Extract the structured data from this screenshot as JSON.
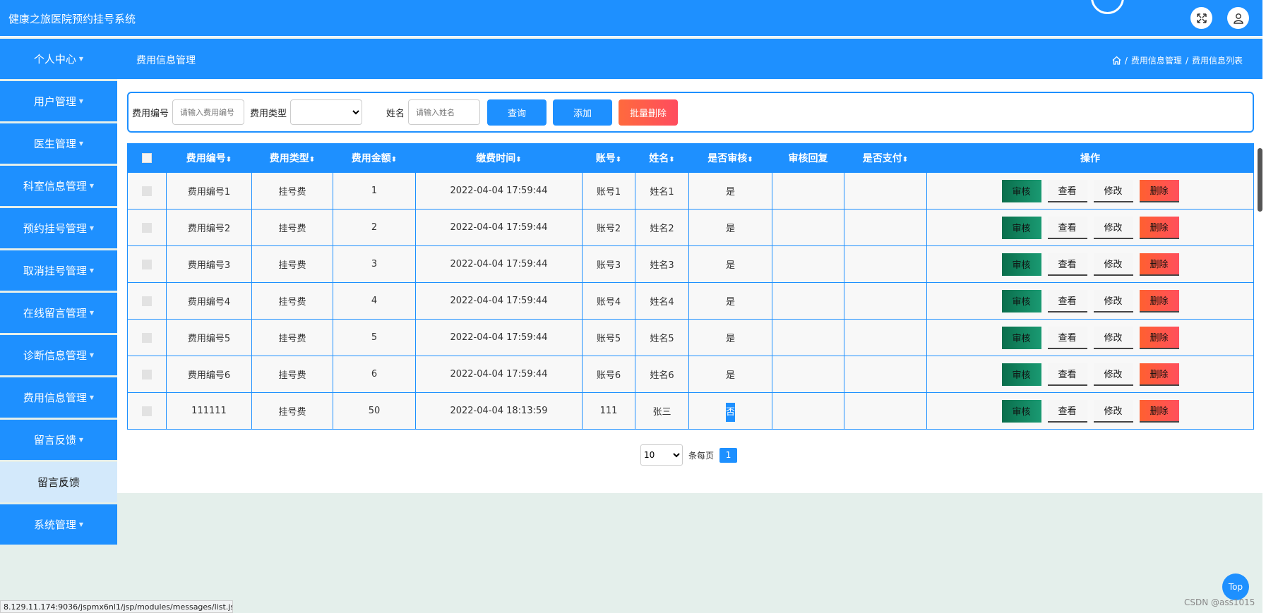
{
  "app": {
    "title": "健康之旅医院预约挂号系统"
  },
  "sidebar": {
    "items": [
      {
        "label": "个人中心"
      },
      {
        "label": "用户管理"
      },
      {
        "label": "医生管理"
      },
      {
        "label": "科室信息管理"
      },
      {
        "label": "预约挂号管理"
      },
      {
        "label": "取消挂号管理"
      },
      {
        "label": "在线留言管理"
      },
      {
        "label": "诊断信息管理"
      },
      {
        "label": "费用信息管理"
      },
      {
        "label": "留言反馈"
      },
      {
        "label": "留言反馈"
      },
      {
        "label": "系统管理"
      }
    ]
  },
  "header": {
    "page_title": "费用信息管理",
    "breadcrumb": [
      "费用信息管理",
      "费用信息列表"
    ]
  },
  "search": {
    "fee_no_label": "费用编号",
    "fee_no_placeholder": "请输入费用编号",
    "fee_type_label": "费用类型",
    "name_label": "姓名",
    "name_placeholder": "请输入姓名",
    "query_button": "查询",
    "add_button": "添加",
    "batch_delete_button": "批量删除"
  },
  "table": {
    "headers": {
      "fee_no": "费用编号",
      "fee_type": "费用类型",
      "amount": "费用金额",
      "pay_time": "缴费时间",
      "account": "账号",
      "name": "姓名",
      "reviewed": "是否审核",
      "review_reply": "审核回复",
      "paid": "是否支付",
      "ops": "操作"
    },
    "rows": [
      {
        "fee_no": "费用编号1",
        "fee_type": "挂号费",
        "amount": "1",
        "pay_time": "2022-04-04 17:59:44",
        "account": "账号1",
        "name": "姓名1",
        "reviewed": "是",
        "review_reply": "",
        "paid": ""
      },
      {
        "fee_no": "费用编号2",
        "fee_type": "挂号费",
        "amount": "2",
        "pay_time": "2022-04-04 17:59:44",
        "account": "账号2",
        "name": "姓名2",
        "reviewed": "是",
        "review_reply": "",
        "paid": ""
      },
      {
        "fee_no": "费用编号3",
        "fee_type": "挂号费",
        "amount": "3",
        "pay_time": "2022-04-04 17:59:44",
        "account": "账号3",
        "name": "姓名3",
        "reviewed": "是",
        "review_reply": "",
        "paid": ""
      },
      {
        "fee_no": "费用编号4",
        "fee_type": "挂号费",
        "amount": "4",
        "pay_time": "2022-04-04 17:59:44",
        "account": "账号4",
        "name": "姓名4",
        "reviewed": "是",
        "review_reply": "",
        "paid": ""
      },
      {
        "fee_no": "费用编号5",
        "fee_type": "挂号费",
        "amount": "5",
        "pay_time": "2022-04-04 17:59:44",
        "account": "账号5",
        "name": "姓名5",
        "reviewed": "是",
        "review_reply": "",
        "paid": ""
      },
      {
        "fee_no": "费用编号6",
        "fee_type": "挂号费",
        "amount": "6",
        "pay_time": "2022-04-04 17:59:44",
        "account": "账号6",
        "name": "姓名6",
        "reviewed": "是",
        "review_reply": "",
        "paid": ""
      },
      {
        "fee_no": "111111",
        "fee_type": "挂号费",
        "amount": "50",
        "pay_time": "2022-04-04 18:13:59",
        "account": "111",
        "name": "张三",
        "reviewed": "否",
        "review_reply": "",
        "paid": ""
      }
    ],
    "actions": {
      "audit": "审核",
      "view": "查看",
      "edit": "修改",
      "delete": "删除"
    }
  },
  "pager": {
    "page_size": "10",
    "per_page_label": "条每页",
    "current_page": "1"
  },
  "scroll_top": "Top",
  "watermark": "CSDN @ass1015",
  "status_url": "8.129.11.174:9036/jspmx6nl1/jsp/modules/messages/list.jsp",
  "colors": {
    "primary": "#1e90ff",
    "danger": "#ff5a4a",
    "audit": "#0a6e4c"
  }
}
